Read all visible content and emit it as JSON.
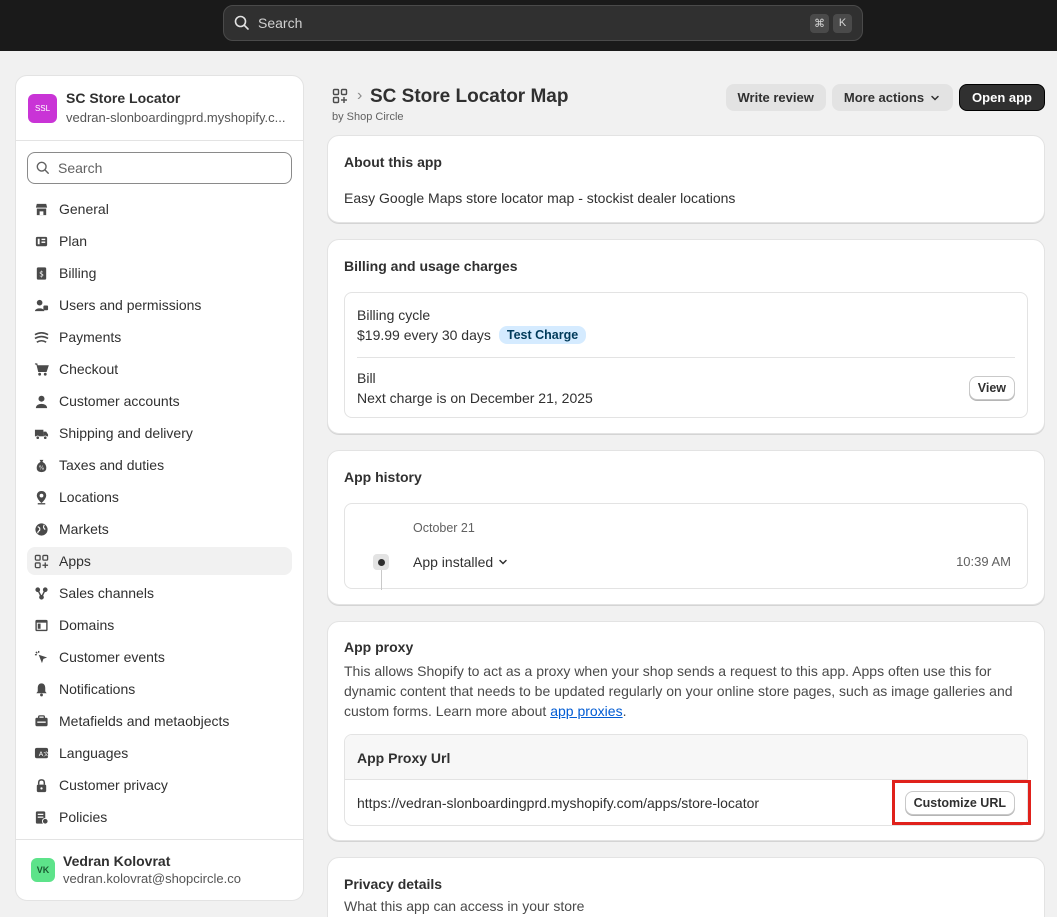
{
  "topbar": {
    "search_placeholder": "Search",
    "shortcut_cmd": "⌘",
    "shortcut_key": "K"
  },
  "store": {
    "initials": "SSL",
    "name": "SC Store Locator",
    "domain": "vedran-slonboardingprd.myshopify.c..."
  },
  "sidebar": {
    "search_placeholder": "Search",
    "items": [
      {
        "label": "General",
        "icon": "store-icon"
      },
      {
        "label": "Plan",
        "icon": "plan-icon"
      },
      {
        "label": "Billing",
        "icon": "billing-icon"
      },
      {
        "label": "Users and permissions",
        "icon": "users-icon"
      },
      {
        "label": "Payments",
        "icon": "payments-icon"
      },
      {
        "label": "Checkout",
        "icon": "cart-icon"
      },
      {
        "label": "Customer accounts",
        "icon": "person-icon"
      },
      {
        "label": "Shipping and delivery",
        "icon": "truck-icon"
      },
      {
        "label": "Taxes and duties",
        "icon": "tax-icon"
      },
      {
        "label": "Locations",
        "icon": "location-icon"
      },
      {
        "label": "Markets",
        "icon": "globe-icon"
      },
      {
        "label": "Apps",
        "icon": "apps-icon",
        "active": true
      },
      {
        "label": "Sales channels",
        "icon": "channels-icon"
      },
      {
        "label": "Domains",
        "icon": "domains-icon"
      },
      {
        "label": "Customer events",
        "icon": "cursor-icon"
      },
      {
        "label": "Notifications",
        "icon": "bell-icon"
      },
      {
        "label": "Metafields and metaobjects",
        "icon": "metafields-icon"
      },
      {
        "label": "Languages",
        "icon": "languages-icon"
      },
      {
        "label": "Customer privacy",
        "icon": "lock-icon"
      },
      {
        "label": "Policies",
        "icon": "policies-icon"
      }
    ]
  },
  "user": {
    "initials": "VK",
    "name": "Vedran Kolovrat",
    "email": "vedran.kolovrat@shopcircle.co"
  },
  "header": {
    "title": "SC Store Locator Map",
    "by": "by Shop Circle",
    "write_review": "Write review",
    "more_actions": "More actions",
    "open_app": "Open app"
  },
  "about": {
    "title": "About this app",
    "text": "Easy Google Maps store locator map - stockist dealer locations"
  },
  "billing": {
    "title": "Billing and usage charges",
    "cycle_label": "Billing cycle",
    "cycle_value": "$19.99 every 30 days",
    "badge": "Test Charge",
    "bill_label": "Bill",
    "bill_value": "Next charge is on December 21, 2025",
    "view": "View"
  },
  "history": {
    "title": "App history",
    "date": "October 21",
    "event": "App installed",
    "time": "10:39 AM"
  },
  "proxy": {
    "title": "App proxy",
    "desc_1": "This allows Shopify to act as a proxy when your shop sends a request to this app. Apps often use this for",
    "desc_2": "dynamic content that needs to be updated regularly on your online store pages, such as image galleries and",
    "desc_3": "custom forms. Learn more about ",
    "link": "app proxies",
    "desc_end": ".",
    "url_label": "App Proxy Url",
    "url": "https://vedran-slonboardingprd.myshopify.com/apps/store-locator",
    "customize": "Customize URL"
  },
  "privacy": {
    "title": "Privacy details",
    "subtitle": "What this app can access in your store"
  },
  "colors": {
    "highlight": "#e0211b",
    "accent_link": "#005bd3",
    "badge_bg": "#d5ebff"
  }
}
